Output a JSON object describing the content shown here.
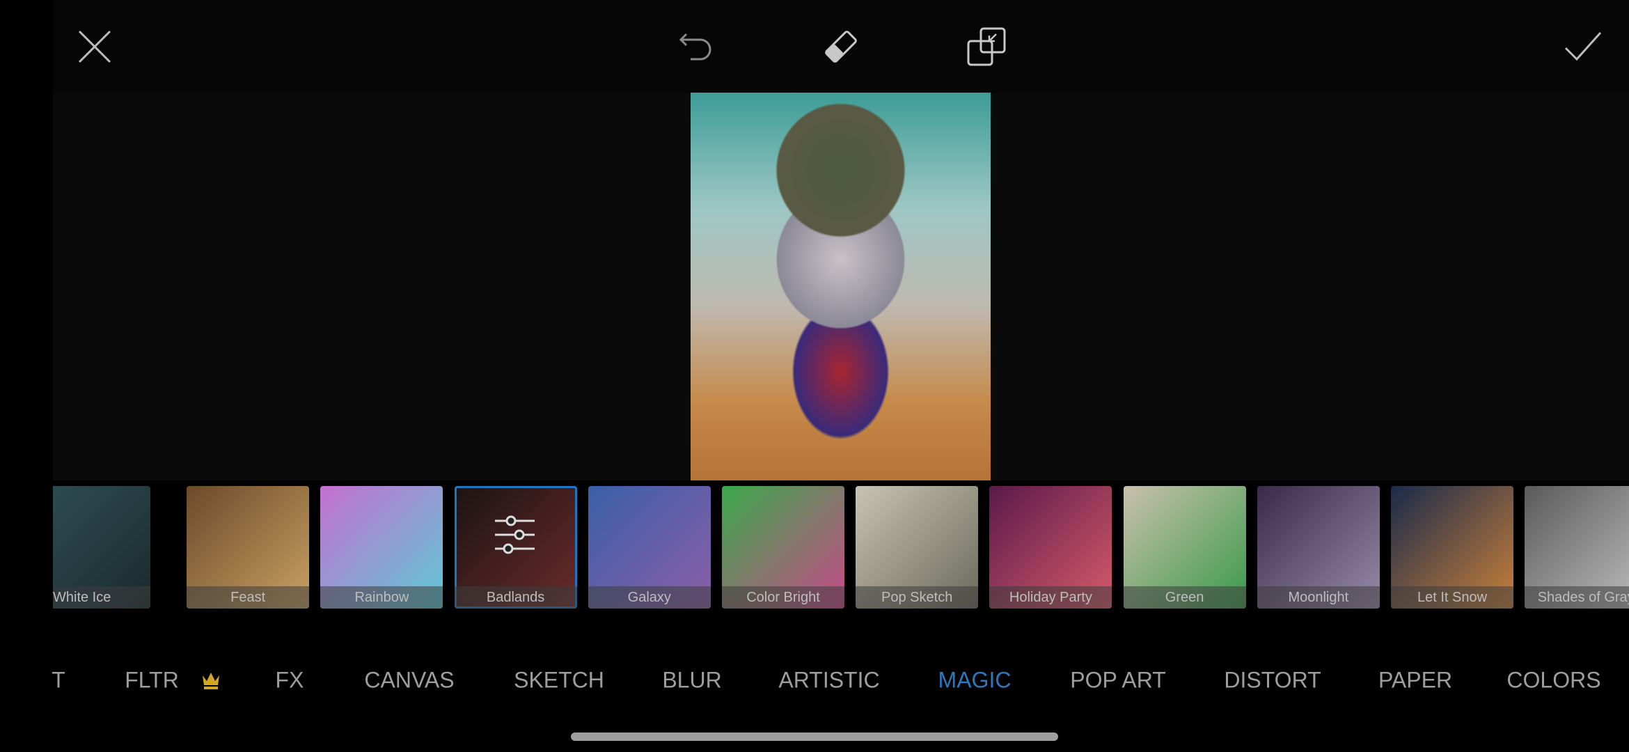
{
  "toolbar": {
    "close_icon": "close-icon",
    "undo_icon": "undo-icon",
    "eraser_icon": "eraser-icon",
    "compare_icon": "compare-icon",
    "apply_icon": "check-icon"
  },
  "effects": [
    {
      "label": "White Ice",
      "c1": "#2f4f55",
      "c2": "#1a2a2e"
    },
    {
      "label": "Feast",
      "c1": "#6b4a2a",
      "c2": "#c9a163"
    },
    {
      "label": "Rainbow",
      "c1": "#c56fcf",
      "c2": "#5ec9d6"
    },
    {
      "label": "Badlands",
      "c1": "#1c1414",
      "c2": "#6a2a2a",
      "selected": true
    },
    {
      "label": "Galaxy",
      "c1": "#3a5fa8",
      "c2": "#8b5fa8"
    },
    {
      "label": "Color Bright",
      "c1": "#3aa84a",
      "c2": "#c84a8a"
    },
    {
      "label": "Pop Sketch",
      "c1": "#c9c3b3",
      "c2": "#6a6a5a"
    },
    {
      "label": "Holiday Party",
      "c1": "#5a1a4a",
      "c2": "#d65a6a"
    },
    {
      "label": "Green",
      "c1": "#c9c0ac",
      "c2": "#3a9a4a"
    },
    {
      "label": "Moonlight",
      "c1": "#3a2a4a",
      "c2": "#9a8aaa"
    },
    {
      "label": "Let It Snow",
      "c1": "#1a2a4a",
      "c2": "#c9803a"
    },
    {
      "label": "Shades of Gray",
      "c1": "#5a5a5a",
      "c2": "#c0c0c0"
    }
  ],
  "categories": [
    {
      "label": "T"
    },
    {
      "label": "FLTR",
      "premium": true
    },
    {
      "label": "FX"
    },
    {
      "label": "CANVAS"
    },
    {
      "label": "SKETCH"
    },
    {
      "label": "BLUR"
    },
    {
      "label": "ARTISTIC"
    },
    {
      "label": "MAGIC",
      "active": true
    },
    {
      "label": "POP ART"
    },
    {
      "label": "DISTORT"
    },
    {
      "label": "PAPER"
    },
    {
      "label": "COLORS"
    }
  ],
  "colors": {
    "accent": "#2a79bd",
    "premium_crown": "#d4a520"
  }
}
